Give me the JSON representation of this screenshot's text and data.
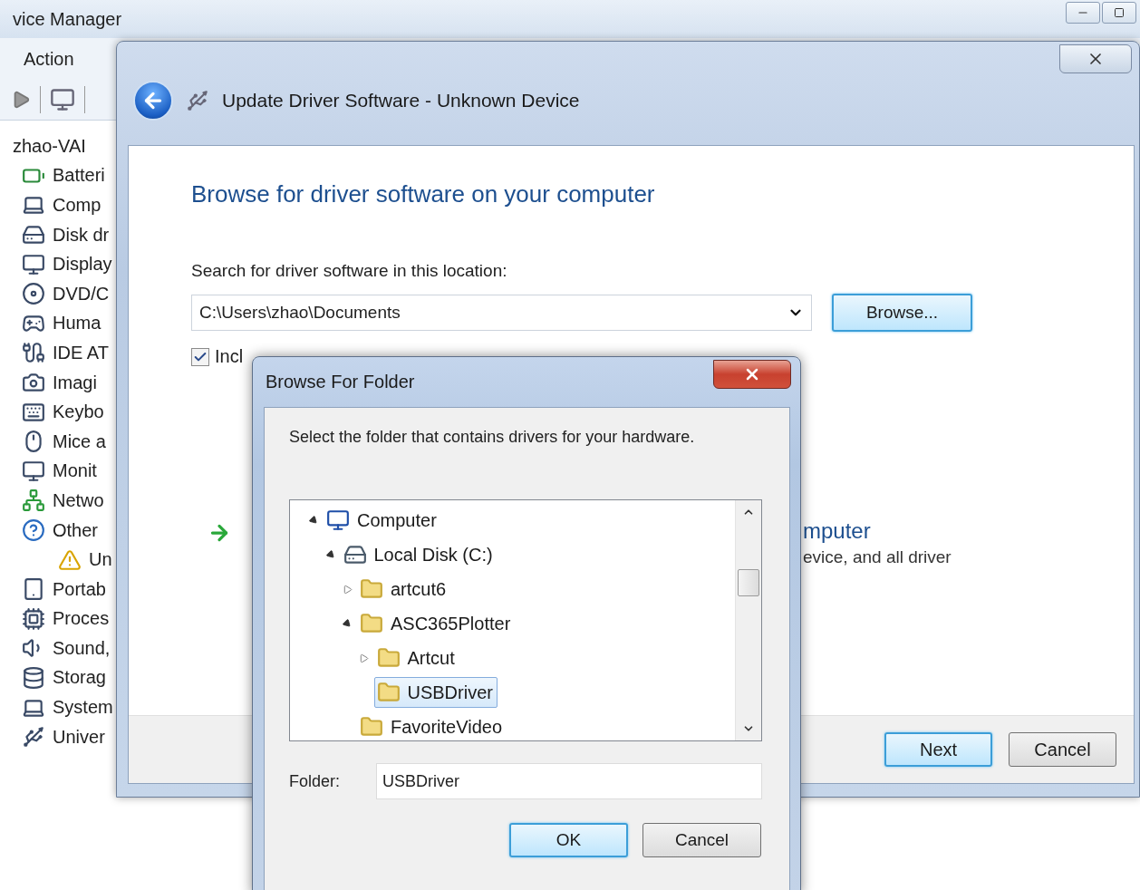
{
  "device_manager": {
    "title": "vice Manager",
    "menu": [
      "Action"
    ],
    "tree": {
      "label": "zhao-VAI",
      "children": [
        {
          "label": "Batteri",
          "kind": "battery"
        },
        {
          "label": "Comp",
          "kind": "computer"
        },
        {
          "label": "Disk dr",
          "kind": "disk"
        },
        {
          "label": "Display",
          "kind": "display"
        },
        {
          "label": "DVD/C",
          "kind": "dvd"
        },
        {
          "label": "Huma",
          "kind": "hid"
        },
        {
          "label": "IDE AT",
          "kind": "ide"
        },
        {
          "label": "Imagi",
          "kind": "camera"
        },
        {
          "label": "Keybo",
          "kind": "keyboard"
        },
        {
          "label": "Mice a",
          "kind": "mouse"
        },
        {
          "label": "Monit",
          "kind": "monitor"
        },
        {
          "label": "Netwo",
          "kind": "network"
        },
        {
          "label": "Other",
          "kind": "other",
          "children": [
            {
              "label": "Un",
              "kind": "warning"
            }
          ]
        },
        {
          "label": "Portab",
          "kind": "portable"
        },
        {
          "label": "Proces",
          "kind": "processor"
        },
        {
          "label": "Sound,",
          "kind": "sound"
        },
        {
          "label": "Storag",
          "kind": "storage"
        },
        {
          "label": "System",
          "kind": "computer"
        },
        {
          "label": "Univer",
          "kind": "usb"
        }
      ]
    }
  },
  "wizard": {
    "title": "Update Driver Software - Unknown Device",
    "heading": "Browse for driver software on your computer",
    "location_label": "Search for driver software in this location:",
    "location": {
      "value": "C:\\Users\\zhao\\Documents"
    },
    "browse_button": "Browse...",
    "include_subfolders": {
      "label": "Incl",
      "checked": true
    },
    "option": {
      "title": "mputer",
      "description": "evice, and all driver"
    },
    "buttons": [
      {
        "label": "Next",
        "default": true
      },
      {
        "label": "Cancel",
        "default": false
      }
    ]
  },
  "browse_dialog": {
    "title": "Browse For Folder",
    "instruction": "Select the folder that contains drivers for your hardware.",
    "tree": [
      {
        "label": "Computer",
        "kind": "computer",
        "expanded": true,
        "selected": false,
        "children": [
          {
            "label": "Local Disk (C:)",
            "kind": "drive",
            "expanded": true,
            "selected": false,
            "children": [
              {
                "label": "artcut6",
                "kind": "folder",
                "expanded": false,
                "selected": false
              },
              {
                "label": "ASC365Plotter",
                "kind": "folder",
                "expanded": true,
                "selected": false,
                "children": [
                  {
                    "label": "Artcut",
                    "kind": "folder",
                    "expanded": false,
                    "selected": false
                  },
                  {
                    "label": "USBDriver",
                    "kind": "folder",
                    "selected": true
                  }
                ]
              },
              {
                "label": "FavoriteVideo",
                "kind": "folder",
                "selected": false
              }
            ]
          }
        ]
      }
    ],
    "folder_label": "Folder:",
    "folder": {
      "value": "USBDriver"
    },
    "buttons": [
      {
        "label": "OK",
        "default": true
      },
      {
        "label": "Cancel",
        "default": false
      }
    ]
  }
}
